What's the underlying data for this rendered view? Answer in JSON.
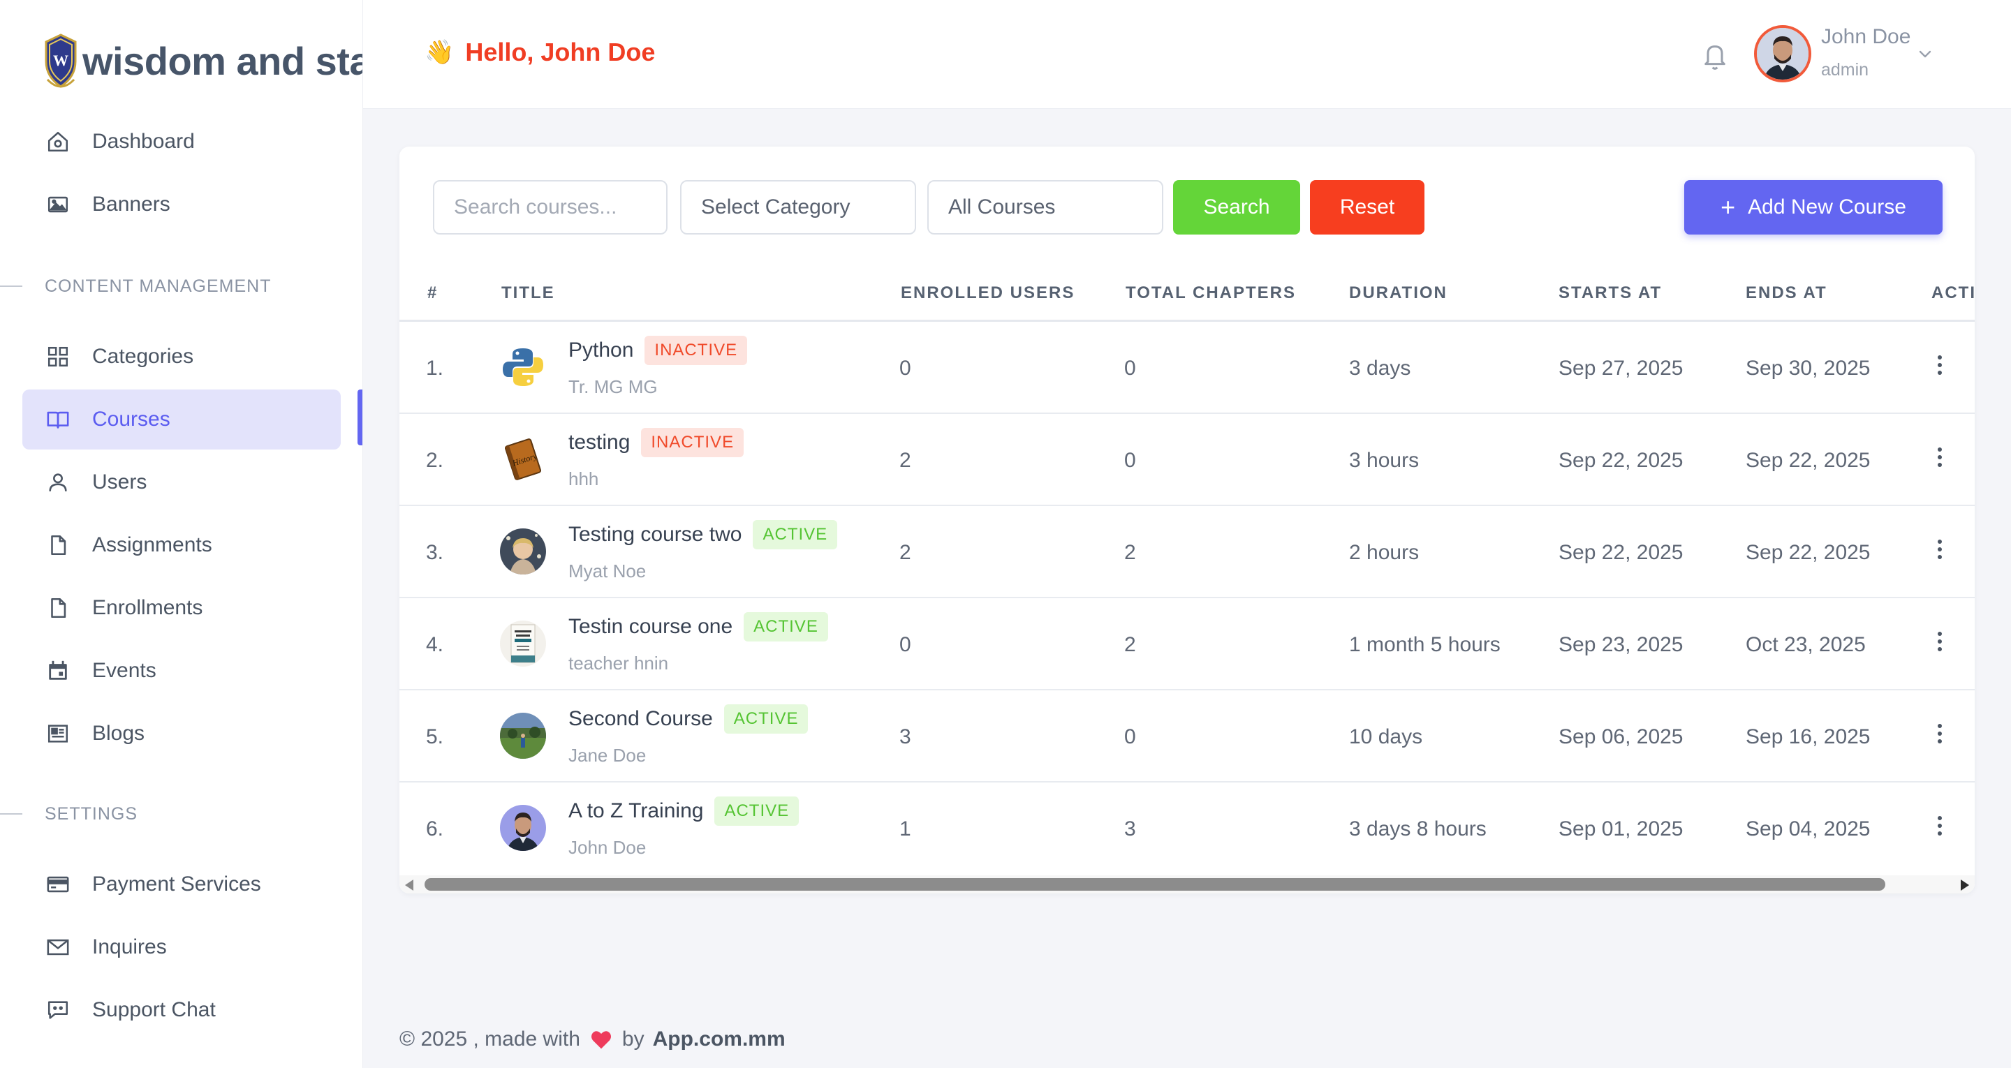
{
  "brand": {
    "name": "wisdom and sta"
  },
  "sidebar": {
    "items_top": [
      {
        "label": "Dashboard",
        "icon": "home-icon"
      },
      {
        "label": "Banners",
        "icon": "image-icon"
      }
    ],
    "section_content": "CONTENT MANAGEMENT",
    "items_content": [
      {
        "label": "Categories",
        "icon": "grid-icon"
      },
      {
        "label": "Courses",
        "icon": "book-icon",
        "active": true
      },
      {
        "label": "Users",
        "icon": "user-icon"
      },
      {
        "label": "Assignments",
        "icon": "file-icon"
      },
      {
        "label": "Enrollments",
        "icon": "file-icon"
      },
      {
        "label": "Events",
        "icon": "calendar-icon"
      },
      {
        "label": "Blogs",
        "icon": "newspaper-icon"
      }
    ],
    "section_settings": "SETTINGS",
    "items_settings": [
      {
        "label": "Payment Services",
        "icon": "credit-card-icon"
      },
      {
        "label": "Inquires",
        "icon": "mail-icon"
      },
      {
        "label": "Support Chat",
        "icon": "chat-icon"
      }
    ]
  },
  "header": {
    "greeting": "Hello, John Doe",
    "wave": "👋",
    "user_name": "John Doe",
    "user_role": "admin"
  },
  "filters": {
    "search_placeholder": "Search courses...",
    "category": "Select Category",
    "courses": "All Courses",
    "search_label": "Search",
    "reset_label": "Reset",
    "add_label": "Add New Course"
  },
  "table": {
    "columns": [
      "#",
      "TITLE",
      "ENROLLED USERS",
      "TOTAL CHAPTERS",
      "DURATION",
      "STARTS AT",
      "ENDS AT",
      "ACTI"
    ],
    "rows": [
      {
        "num": "1.",
        "title": "Python",
        "status": "INACTIVE",
        "sub": "Tr. MG MG",
        "enrolled": "0",
        "chapters": "0",
        "duration": "3 days",
        "starts": "Sep 27, 2025",
        "ends": "Sep 30, 2025"
      },
      {
        "num": "2.",
        "title": "testing",
        "status": "INACTIVE",
        "sub": "hhh",
        "enrolled": "2",
        "chapters": "0",
        "duration": "3 hours",
        "starts": "Sep 22, 2025",
        "ends": "Sep 22, 2025"
      },
      {
        "num": "3.",
        "title": "Testing course two",
        "status": "ACTIVE",
        "sub": "Myat Noe",
        "enrolled": "2",
        "chapters": "2",
        "duration": "2 hours",
        "starts": "Sep 22, 2025",
        "ends": "Sep 22, 2025"
      },
      {
        "num": "4.",
        "title": "Testin course one",
        "status": "ACTIVE",
        "sub": "teacher hnin",
        "enrolled": "0",
        "chapters": "2",
        "duration": "1 month 5 hours",
        "starts": "Sep 23, 2025",
        "ends": "Oct 23, 2025"
      },
      {
        "num": "5.",
        "title": "Second Course",
        "status": "ACTIVE",
        "sub": "Jane Doe",
        "enrolled": "3",
        "chapters": "0",
        "duration": "10 days",
        "starts": "Sep 06, 2025",
        "ends": "Sep 16, 2025"
      },
      {
        "num": "6.",
        "title": "A to Z Training",
        "status": "ACTIVE",
        "sub": "John Doe",
        "enrolled": "1",
        "chapters": "3",
        "duration": "3 days 8 hours",
        "starts": "Sep 01, 2025",
        "ends": "Sep 04, 2025"
      }
    ]
  },
  "footer": {
    "prefix": "© 2025 , made with",
    "by": "by",
    "brand": "App.com.mm"
  },
  "colors": {
    "accent": "#6366f1",
    "greeting": "#f03d23",
    "search_button": "#64d539",
    "reset_button": "#f73e1f",
    "inactive_badge_bg": "#fde3de",
    "active_badge_bg": "#e5f9dc"
  }
}
